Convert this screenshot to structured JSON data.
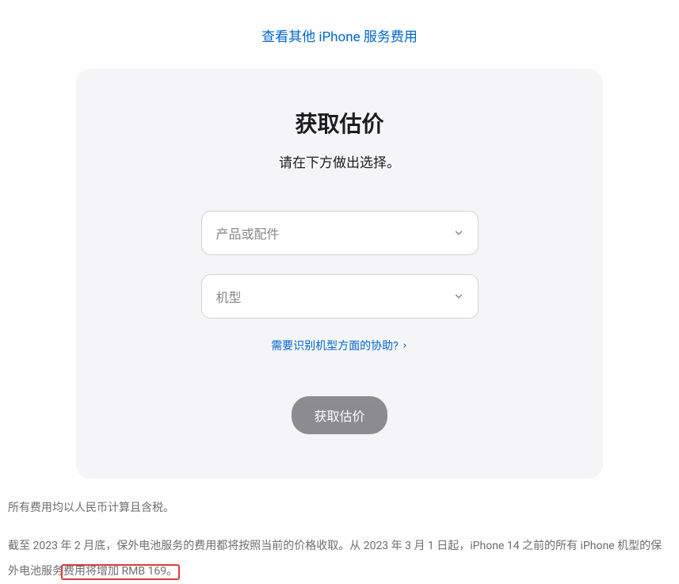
{
  "topLink": {
    "label": "查看其他 iPhone 服务费用"
  },
  "card": {
    "title": "获取估价",
    "subtitle": "请在下方做出选择。",
    "selectProduct": {
      "placeholder": "产品或配件"
    },
    "selectModel": {
      "placeholder": "机型"
    },
    "helpLink": {
      "label": "需要识别机型方面的协助?"
    },
    "submitButton": {
      "label": "获取估价"
    }
  },
  "footer": {
    "line1": "所有费用均以人民币计算且含税。",
    "line2_part1": "截至 2023 年 2 月底，保外电池服务的费用都将按照当前的价格收取。从 2023 年 3 月 1 日起，iPhone 14 之前的所有 iPhone 机型的保外电池服务",
    "line2_highlighted": "费用将增加 RMB 169。"
  },
  "colors": {
    "link": "#0066cc",
    "cardBg": "#f5f5f7",
    "border": "#d2d2d7",
    "muted": "#86868b",
    "highlight": "#e03a3a"
  }
}
